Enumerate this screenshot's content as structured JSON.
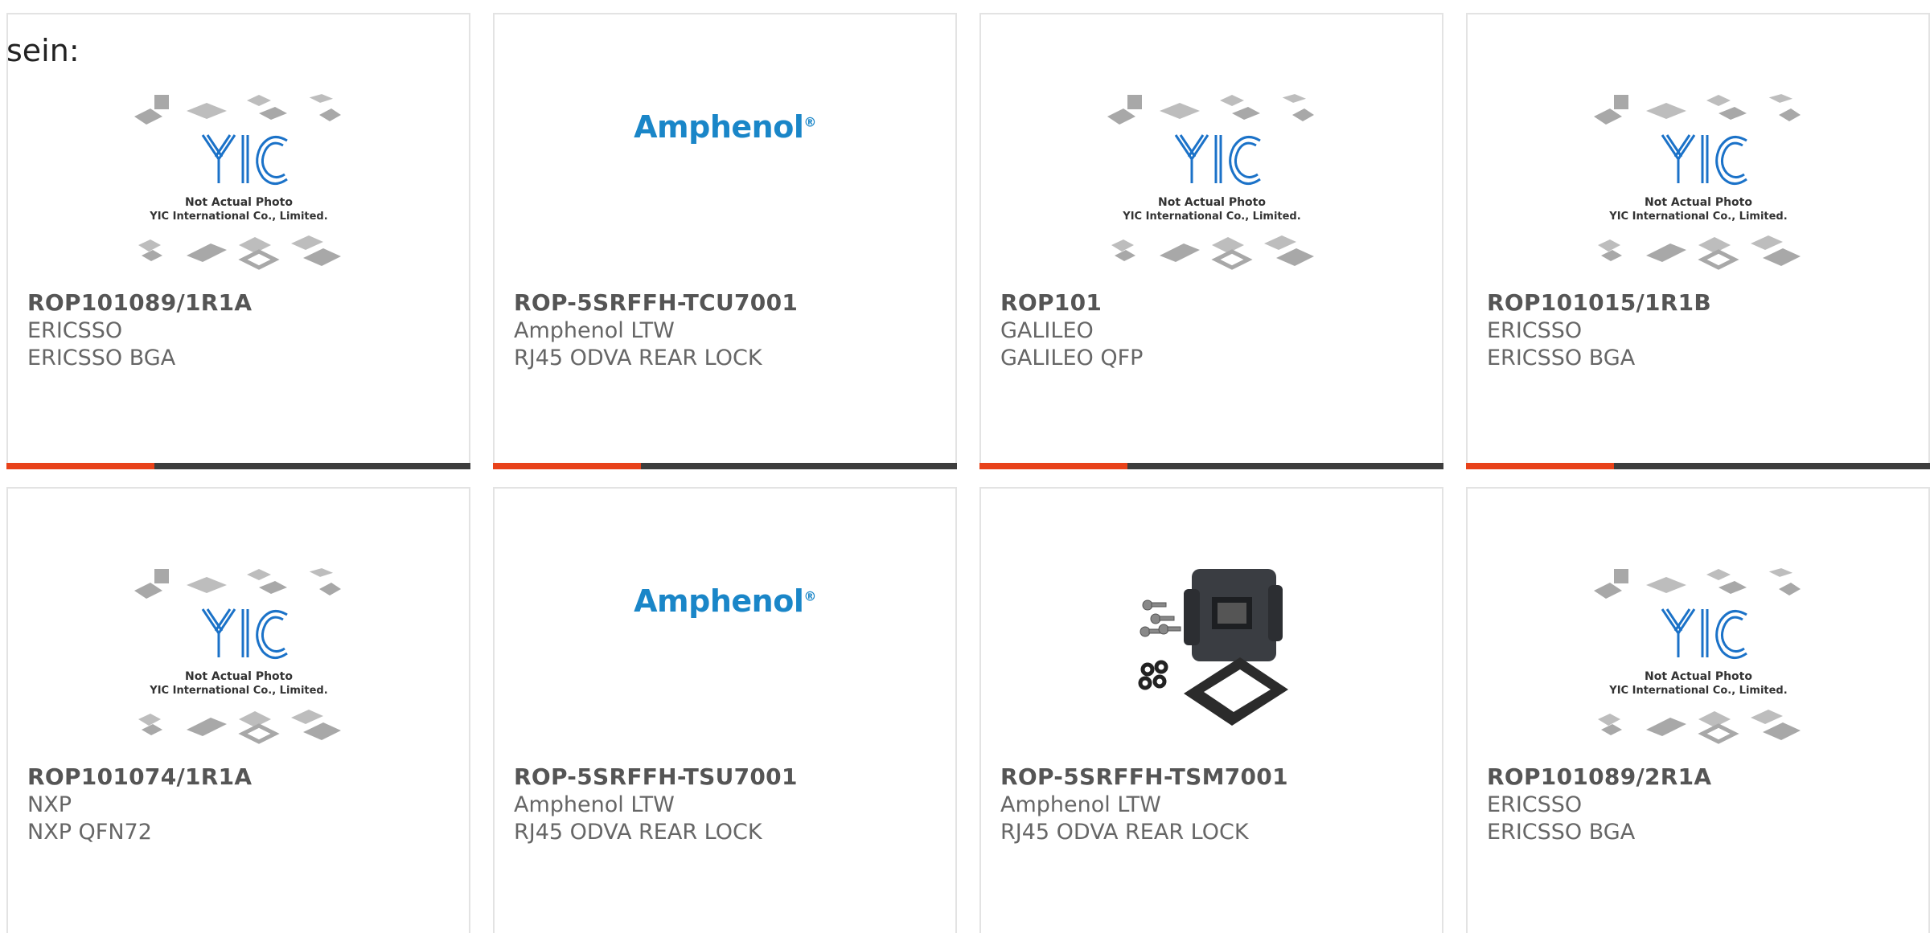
{
  "intro_text": "sein:",
  "colors": {
    "accent": "#e8421a",
    "bar_dark": "#3d3d3d",
    "amphenol_blue": "#1a86c8",
    "yic_blue": "#1b72c8"
  },
  "placeholder": {
    "line1": "Not Actual Photo",
    "line2": "YIC International Co., Limited."
  },
  "amphenol_logo": "Amphenol",
  "products": [
    {
      "part_no": "ROP101089/1R1A",
      "manufacturer": "ERICSSO",
      "description": "ERICSSO BGA",
      "image": "yic-placeholder"
    },
    {
      "part_no": "ROP-5SRFFH-TCU7001",
      "manufacturer": "Amphenol LTW",
      "description": "RJ45 ODVA REAR LOCK",
      "image": "amphenol-logo"
    },
    {
      "part_no": "ROP101",
      "manufacturer": "GALILEO",
      "description": "GALILEO QFP",
      "image": "yic-placeholder"
    },
    {
      "part_no": "ROP101015/1R1B",
      "manufacturer": "ERICSSO",
      "description": "ERICSSO BGA",
      "image": "yic-placeholder"
    },
    {
      "part_no": "ROP101074/1R1A",
      "manufacturer": "NXP",
      "description": "NXP QFN72",
      "image": "yic-placeholder"
    },
    {
      "part_no": "ROP-5SRFFH-TSU7001",
      "manufacturer": "Amphenol LTW",
      "description": "RJ45 ODVA REAR LOCK",
      "image": "amphenol-logo"
    },
    {
      "part_no": "ROP-5SRFFH-TSM7001",
      "manufacturer": "Amphenol LTW",
      "description": "RJ45 ODVA REAR LOCK",
      "image": "connector-photo"
    },
    {
      "part_no": "ROP101089/2R1A",
      "manufacturer": "ERICSSO",
      "description": "ERICSSO BGA",
      "image": "yic-placeholder"
    }
  ]
}
